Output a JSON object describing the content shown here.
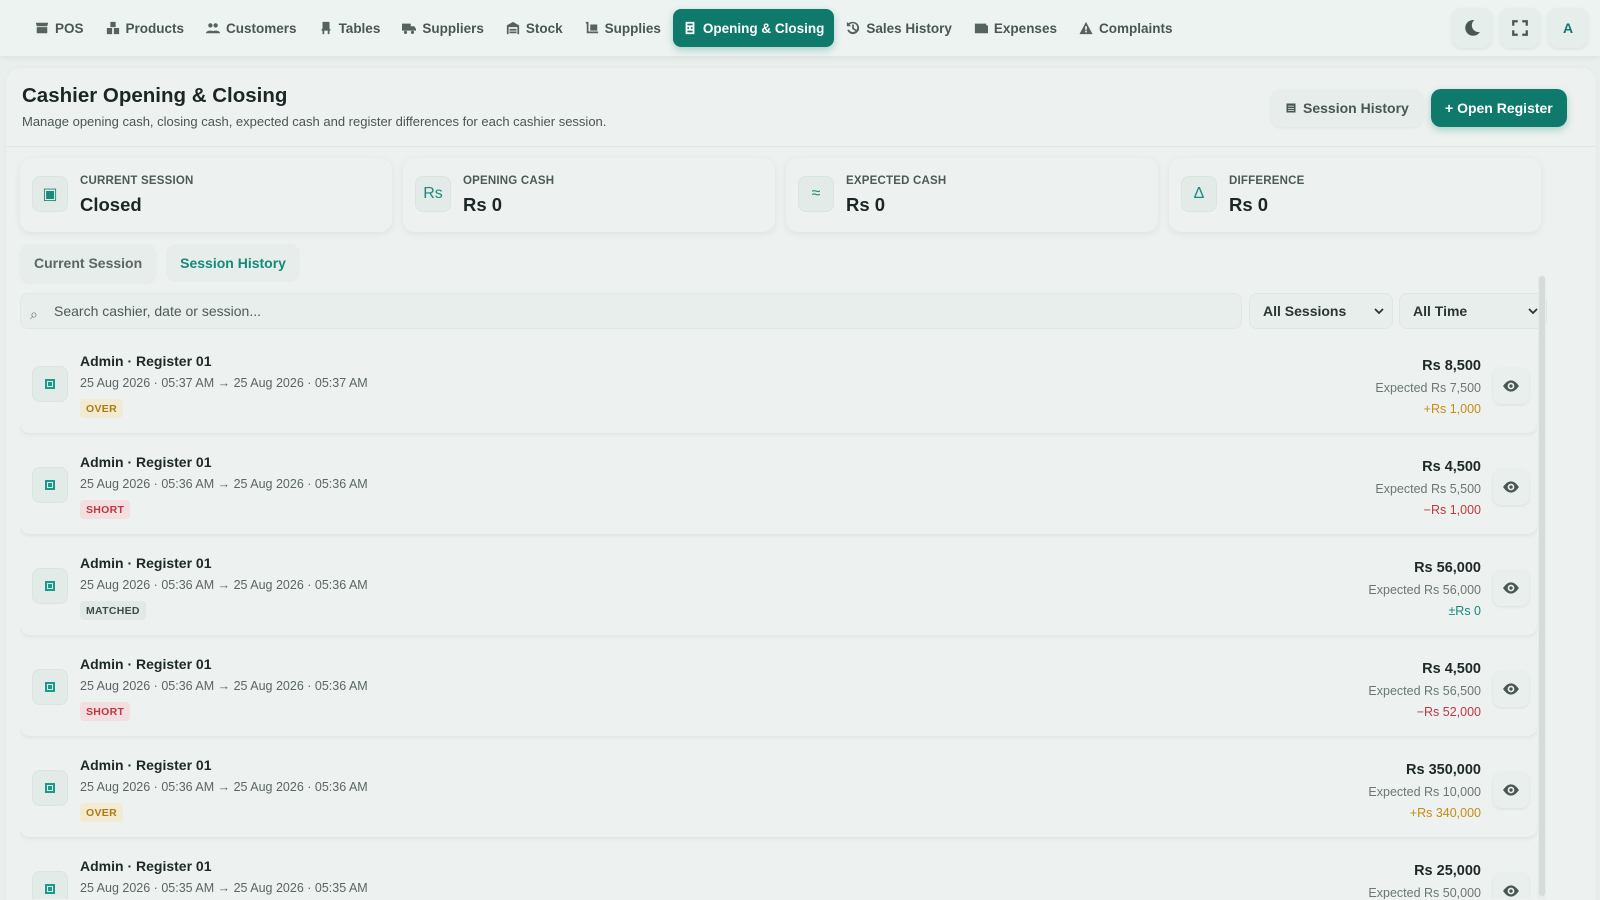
{
  "nav": {
    "items": [
      {
        "label": "POS",
        "icon": "store-icon",
        "active": false
      },
      {
        "label": "Products",
        "icon": "boxes-icon",
        "active": false
      },
      {
        "label": "Customers",
        "icon": "users-icon",
        "active": false
      },
      {
        "label": "Tables",
        "icon": "chair-icon",
        "active": false
      },
      {
        "label": "Suppliers",
        "icon": "truck-icon",
        "active": false
      },
      {
        "label": "Stock",
        "icon": "warehouse-icon",
        "active": false
      },
      {
        "label": "Supplies",
        "icon": "dolly-icon",
        "active": false
      },
      {
        "label": "Opening & Closing",
        "icon": "register-icon",
        "active": true
      },
      {
        "label": "Sales History",
        "icon": "history-icon",
        "active": false
      },
      {
        "label": "Expenses",
        "icon": "wallet-icon",
        "active": false
      },
      {
        "label": "Complaints",
        "icon": "warning-icon",
        "active": false
      }
    ],
    "avatar_letter": "A"
  },
  "header": {
    "title": "Cashier Opening & Closing",
    "subtitle": "Manage opening cash, closing cash, expected cash and register differences for each cashier session.",
    "session_history_button": "Session History",
    "open_register_button": "+ Open Register"
  },
  "stats": [
    {
      "label": "Current Session",
      "value": "Closed",
      "icon_glyph": "▣"
    },
    {
      "label": "Opening Cash",
      "value": "Rs 0",
      "icon_glyph": "Rs"
    },
    {
      "label": "Expected Cash",
      "value": "Rs 0",
      "icon_glyph": "≈"
    },
    {
      "label": "Difference",
      "value": "Rs 0",
      "icon_glyph": "Δ"
    }
  ],
  "tabs": {
    "current": "Current Session",
    "history": "Session History"
  },
  "filters": {
    "search_placeholder": "Search cashier, date or session...",
    "sessions_selected": "All Sessions",
    "time_selected": "All Time"
  },
  "sessions": [
    {
      "title": "Admin · Register 01",
      "time": "25 Aug 2026 · 05:37 AM → 25 Aug 2026 · 05:37 AM",
      "status": "OVER",
      "amount": "Rs 8,500",
      "expected": "Expected Rs 7,500",
      "difference": "+Rs 1,000"
    },
    {
      "title": "Admin · Register 01",
      "time": "25 Aug 2026 · 05:36 AM → 25 Aug 2026 · 05:36 AM",
      "status": "SHORT",
      "amount": "Rs 4,500",
      "expected": "Expected Rs 5,500",
      "difference": "−Rs 1,000"
    },
    {
      "title": "Admin · Register 01",
      "time": "25 Aug 2026 · 05:36 AM → 25 Aug 2026 · 05:36 AM",
      "status": "MATCHED",
      "amount": "Rs 56,000",
      "expected": "Expected Rs 56,000",
      "difference": "±Rs 0"
    },
    {
      "title": "Admin · Register 01",
      "time": "25 Aug 2026 · 05:36 AM → 25 Aug 2026 · 05:36 AM",
      "status": "SHORT",
      "amount": "Rs 4,500",
      "expected": "Expected Rs 56,500",
      "difference": "−Rs 52,000"
    },
    {
      "title": "Admin · Register 01",
      "time": "25 Aug 2026 · 05:36 AM → 25 Aug 2026 · 05:36 AM",
      "status": "OVER",
      "amount": "Rs 350,000",
      "expected": "Expected Rs 10,000",
      "difference": "+Rs 340,000"
    },
    {
      "title": "Admin · Register 01",
      "time": "25 Aug 2026 · 05:35 AM → 25 Aug 2026 · 05:35 AM",
      "status": "",
      "amount": "Rs 25,000",
      "expected": "Expected Rs 50,000",
      "difference": ""
    }
  ],
  "colors": {
    "accent": "#0f7a6c",
    "over": "#c98a12",
    "short": "#c0373f",
    "matched": "#138a7a"
  }
}
